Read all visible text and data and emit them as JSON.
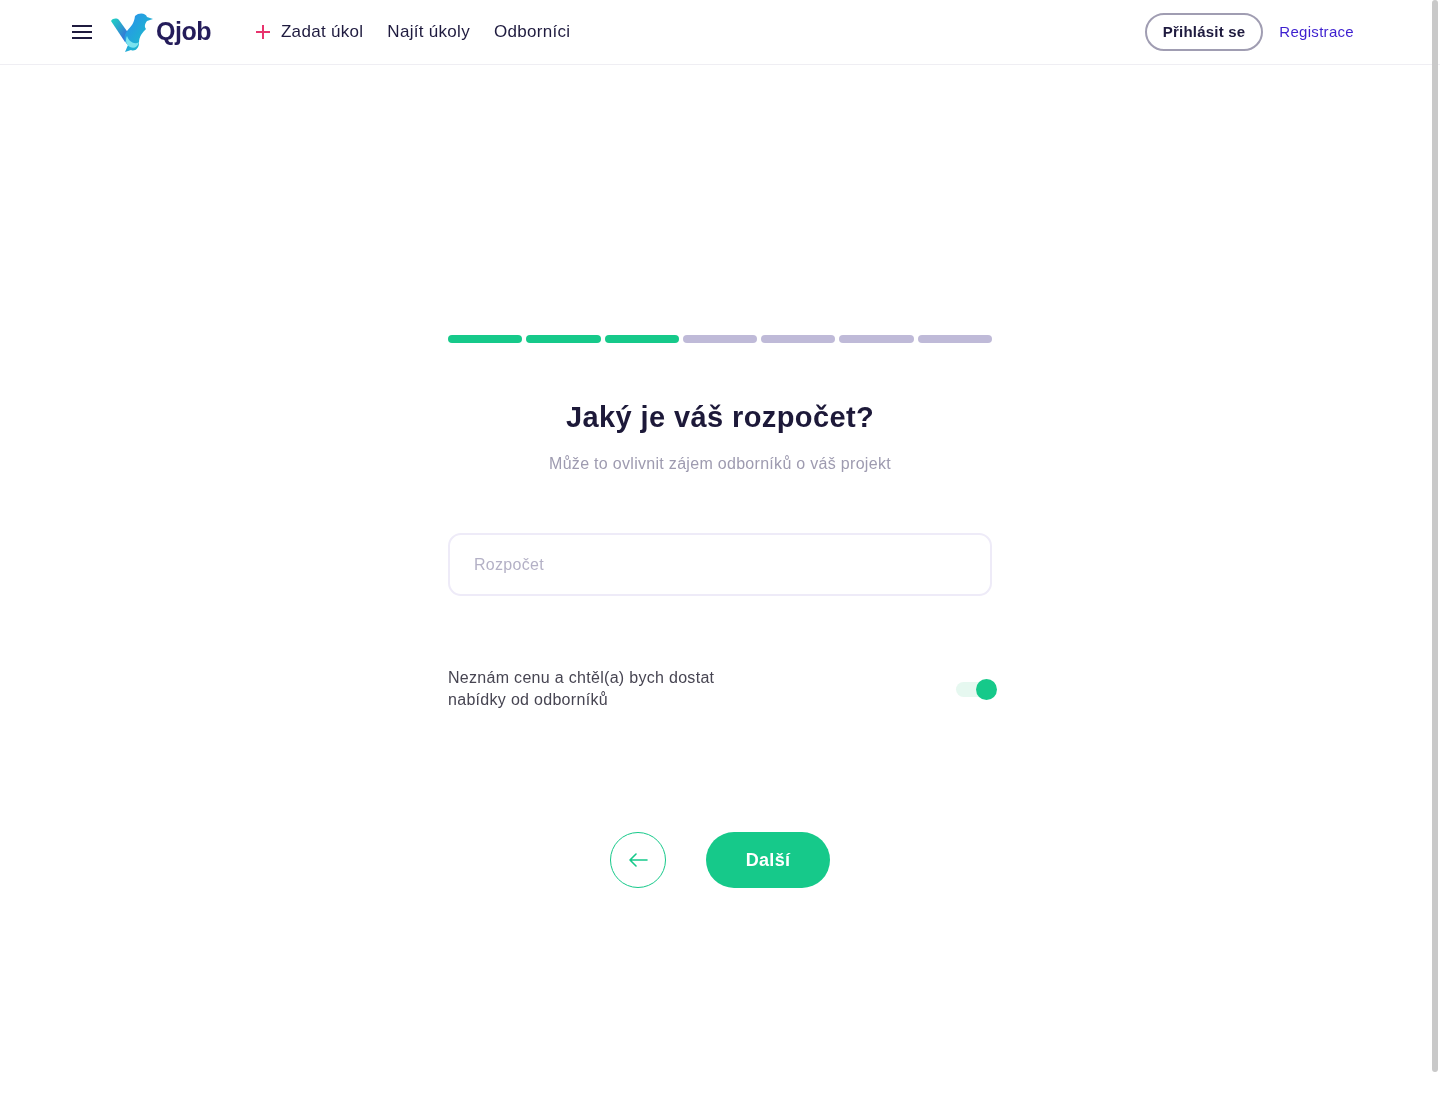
{
  "navbar": {
    "logo_text": "Qjob",
    "links": [
      {
        "label": "Zadat úkol",
        "kind": "add"
      },
      {
        "label": "Najít úkoly",
        "kind": "plain"
      },
      {
        "label": "Odborníci",
        "kind": "plain"
      }
    ],
    "login_button": "Přihlásit se",
    "register_link": "Registrace"
  },
  "progress": {
    "steps": [
      {
        "done": true
      },
      {
        "done": true
      },
      {
        "done": true
      },
      {
        "done": false
      },
      {
        "done": false
      },
      {
        "done": false
      },
      {
        "done": false
      }
    ]
  },
  "question": {
    "title": "Jaký je váš rozpočet?",
    "subtitle": "Může to ovlivnit zájem odborníků o váš projekt"
  },
  "budget_field": {
    "placeholder": "Rozpočet"
  },
  "unknown_price": {
    "label": "Neznám cenu a chtěl(a) bych dostat nabídky od odborníků",
    "on": true
  },
  "next_button": "Další"
}
